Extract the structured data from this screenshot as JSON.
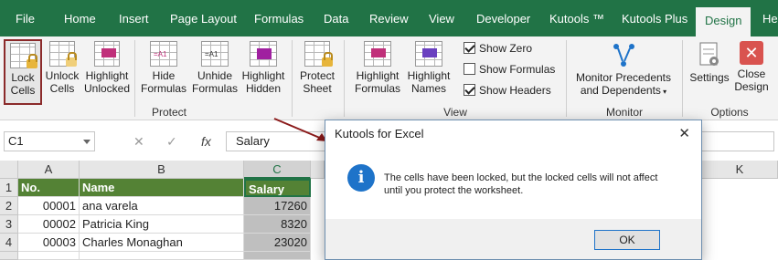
{
  "tabs": [
    "File",
    "Home",
    "Insert",
    "Page Layout",
    "Formulas",
    "Data",
    "Review",
    "View",
    "Developer",
    "Kutools ™",
    "Kutools Plus",
    "Design",
    "He"
  ],
  "ribbon": {
    "protect": {
      "lock_cells": [
        "Lock",
        "Cells"
      ],
      "unlock_cells": [
        "Unlock",
        "Cells"
      ],
      "highlight_unlocked": [
        "Highlight",
        "Unlocked"
      ],
      "hide_formulas": [
        "Hide",
        "Formulas"
      ],
      "unhide_formulas": [
        "Unhide",
        "Formulas"
      ],
      "highlight_hidden": [
        "Highlight",
        "Hidden"
      ],
      "protect_sheet": [
        "Protect",
        "Sheet"
      ],
      "label": "Protect",
      "icon_text": "=A1"
    },
    "view": {
      "highlight_formulas": [
        "Highlight",
        "Formulas"
      ],
      "highlight_names": [
        "Highlight",
        "Names"
      ],
      "show_zero": "Show Zero",
      "show_formulas": "Show Formulas",
      "show_headers": "Show Headers",
      "show_zero_checked": true,
      "show_formulas_checked": false,
      "show_headers_checked": true,
      "label": "View"
    },
    "monitor": {
      "monitor_precedents": [
        "Monitor Precedents",
        "and Dependents"
      ],
      "label": "Monitor"
    },
    "options": {
      "settings": "Settings",
      "close_design": [
        "Close",
        "Design"
      ],
      "label": "Options"
    }
  },
  "formula_bar": {
    "name_box": "C1",
    "cancel": "✕",
    "enter": "✓",
    "fx": "fx",
    "content": "Salary"
  },
  "sheet": {
    "columns": [
      "A",
      "B",
      "C",
      "K"
    ],
    "rows": [
      "1",
      "2",
      "3",
      "4"
    ],
    "header": [
      "No.",
      "Name",
      "Salary"
    ],
    "data": [
      [
        "00001",
        "ana varela",
        "17260"
      ],
      [
        "00002",
        "Patricia King",
        "8320"
      ],
      [
        "00003",
        "Charles Monaghan",
        "23020"
      ]
    ]
  },
  "dialog": {
    "title": "Kutools for Excel",
    "close": "✕",
    "message_line1": "The cells have been locked, but the locked cells will not affect",
    "message_line2": "until you protect the worksheet.",
    "ok": "OK"
  },
  "colors": {
    "excel_green": "#217346",
    "header_fill": "#548235",
    "info_blue": "#1e73c9"
  }
}
